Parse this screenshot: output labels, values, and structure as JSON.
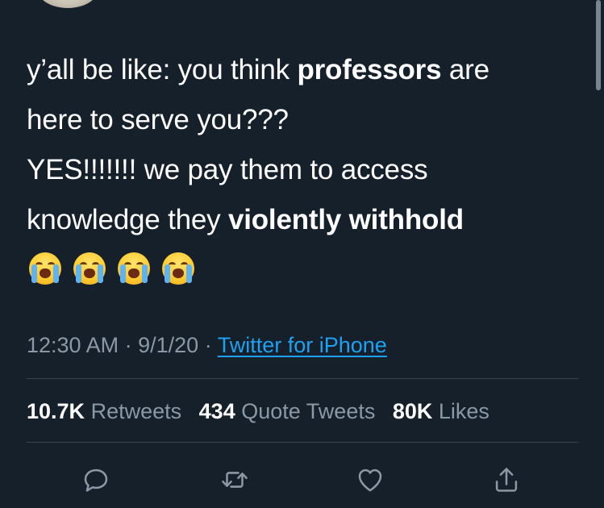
{
  "tweet": {
    "lines": [
      [
        {
          "t": "y’all be like: you think ",
          "b": false
        },
        {
          "t": "professors",
          "b": true
        },
        {
          "t": " are",
          "b": false
        }
      ],
      [
        {
          "t": "here to serve you???",
          "b": false
        }
      ],
      [
        {
          "t": "YES!!!!!!! we pay them to access",
          "b": false
        }
      ],
      [
        {
          "t": "knowledge they ",
          "b": false
        },
        {
          "t": "violently withhold",
          "b": true
        }
      ]
    ],
    "emojis": [
      "loudly-crying-face",
      "loudly-crying-face",
      "loudly-crying-face",
      "loudly-crying-face"
    ]
  },
  "meta": {
    "time": "12:30 AM",
    "separator": "·",
    "date": "9/1/20",
    "source": "Twitter for iPhone"
  },
  "stats": {
    "retweets_count": "10.7K",
    "retweets_label": "Retweets",
    "quotes_count": "434",
    "quotes_label": "Quote Tweets",
    "likes_count": "80K",
    "likes_label": "Likes"
  },
  "actions": [
    {
      "name": "reply-button",
      "icon": "reply-icon"
    },
    {
      "name": "retweet-button",
      "icon": "retweet-icon"
    },
    {
      "name": "like-button",
      "icon": "heart-icon"
    },
    {
      "name": "share-button",
      "icon": "share-icon"
    }
  ],
  "colors": {
    "background": "#15202b",
    "text": "#ffffff",
    "secondary": "#8b98a5",
    "link": "#1da1f2",
    "divider": "#38444d"
  }
}
